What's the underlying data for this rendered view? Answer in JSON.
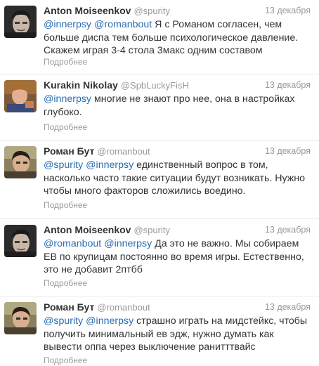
{
  "tweets": [
    {
      "fullname": "Anton Moiseenkov",
      "username": "@spurity",
      "date": "13 декабря",
      "mentions": [
        "@innerpsy",
        "@romanbout"
      ],
      "body": "Я с Романом согласен, чем больше диспа тем больше психологическое давление. Скажем играя 3-4 стола 3макс одним составом",
      "more": "Подробнее",
      "avatar": "avatar-anton"
    },
    {
      "fullname": "Kurakin Nikolay",
      "username": "@SpbLuckyFisH",
      "date": "13 декабря",
      "mentions": [
        "@innerpsy"
      ],
      "body": "многие не знают про нее, она в настройках глубоко.",
      "more": "Подробнее",
      "avatar": "avatar-kurakin"
    },
    {
      "fullname": "Роман Бут",
      "username": "@romanbout",
      "date": "13 декабря",
      "mentions": [
        "@spurity",
        "@innerpsy"
      ],
      "body": "единственный вопрос в том, насколько часто такие ситуации будут возникать. Нужно чтобы много факторов сложились воедино.",
      "more": "Подробнее",
      "avatar": "avatar-roman"
    },
    {
      "fullname": "Anton Moiseenkov",
      "username": "@spurity",
      "date": "13 декабря",
      "mentions": [
        "@romanbout",
        "@innerpsy"
      ],
      "body": "Да это не важно. Мы собираем EB по крупицам постоянно во время игры. Естественно, это не добавит 2птбб",
      "more": "Подробнее",
      "avatar": "avatar-anton"
    },
    {
      "fullname": "Роман Бут",
      "username": "@romanbout",
      "date": "13 декабря",
      "mentions": [
        "@spurity",
        "@innerpsy"
      ],
      "body": "страшно играть на мидстейкс, чтобы получить минимальный ев эдж, нужно думать как вывести оппа через выключение ранитттвайс",
      "more": "Подробнее",
      "avatar": "avatar-roman"
    }
  ]
}
